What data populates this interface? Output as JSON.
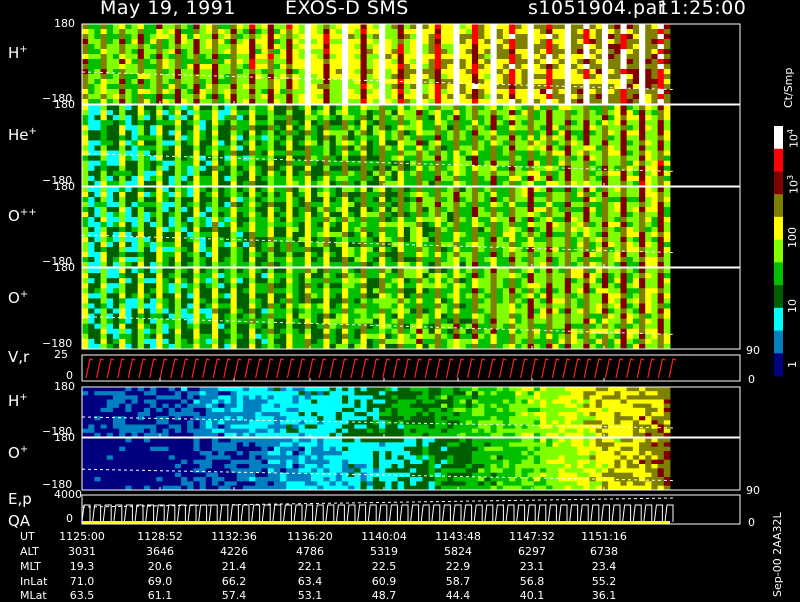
{
  "header": {
    "date": "May 19, 1991",
    "instrument": "EXOS-D SMS",
    "file": "s1051904.par",
    "time": "11:25:00"
  },
  "colors": {
    "background": "#000000",
    "frame": "#ffffff",
    "dashed_trace": "#ffffff",
    "velocity_trace": "#ff2020",
    "ep_trace": "#ffffff",
    "qa_bar": "#ffff00"
  },
  "chart_data": {
    "type": "heatmap",
    "panels": [
      {
        "id": "h-plus",
        "species": "H",
        "charge": "+",
        "tick_top": "180",
        "tick_bottom": "−180",
        "kind": "spectrogram"
      },
      {
        "id": "he-plus",
        "species": "He",
        "charge": "+",
        "tick_top": "180",
        "tick_bottom": "−180",
        "kind": "spectrogram"
      },
      {
        "id": "o-plus-plus",
        "species": "O",
        "charge": "++",
        "tick_top": "180",
        "tick_bottom": "−180",
        "kind": "spectrogram"
      },
      {
        "id": "o-plus",
        "species": "O",
        "charge": "+",
        "tick_top": "180",
        "tick_bottom": "−180",
        "kind": "spectrogram"
      },
      {
        "id": "vr",
        "species": "V,r",
        "tick_top": "25",
        "tick_bottom": "0",
        "right_top": "90",
        "right_bottom": "0",
        "kind": "line"
      },
      {
        "id": "h-plus-2",
        "species": "H",
        "charge": "+",
        "tick_top": "180",
        "tick_bottom": "−180",
        "kind": "spectrogram"
      },
      {
        "id": "o-plus-2",
        "species": "O",
        "charge": "+",
        "tick_top": "180",
        "tick_bottom": "−180",
        "kind": "spectrogram"
      },
      {
        "id": "ep-qa",
        "species": "E,p",
        "species2": "QA",
        "tick_top": "4000",
        "tick_bottom": "0",
        "right_top": "90",
        "right_bottom": "0",
        "kind": "line"
      }
    ],
    "colorbar": {
      "label": "Ct/Smp",
      "ticks": [
        "10^4",
        "10^3",
        "100",
        "10",
        "1"
      ],
      "stops": [
        "#ffffff",
        "#ff0000",
        "#800000",
        "#808000",
        "#ffff00",
        "#80ff00",
        "#00c000",
        "#006000",
        "#00ffff",
        "#0080c0",
        "#000080"
      ]
    },
    "time_axis": {
      "labels": [
        {
          "name": "UT",
          "values": [
            "1125:00",
            "1128:52",
            "1132:36",
            "1136:20",
            "1140:04",
            "1143:48",
            "1147:32",
            "1151:16"
          ]
        },
        {
          "name": "ALT",
          "values": [
            "3031",
            "3646",
            "4226",
            "4786",
            "5319",
            "5824",
            "6297",
            "6738"
          ]
        },
        {
          "name": "MLT",
          "values": [
            "19.3",
            "20.6",
            "21.4",
            "22.1",
            "22.5",
            "22.9",
            "23.1",
            "23.4"
          ]
        },
        {
          "name": "InLat",
          "values": [
            "71.0",
            "69.0",
            "66.2",
            "63.4",
            "60.9",
            "58.7",
            "56.8",
            "55.2"
          ]
        },
        {
          "name": "MLat",
          "values": [
            "63.5",
            "61.1",
            "57.4",
            "53.1",
            "48.7",
            "44.4",
            "40.1",
            "36.1"
          ]
        }
      ]
    }
  },
  "version": "Sep-00 2AA32L"
}
